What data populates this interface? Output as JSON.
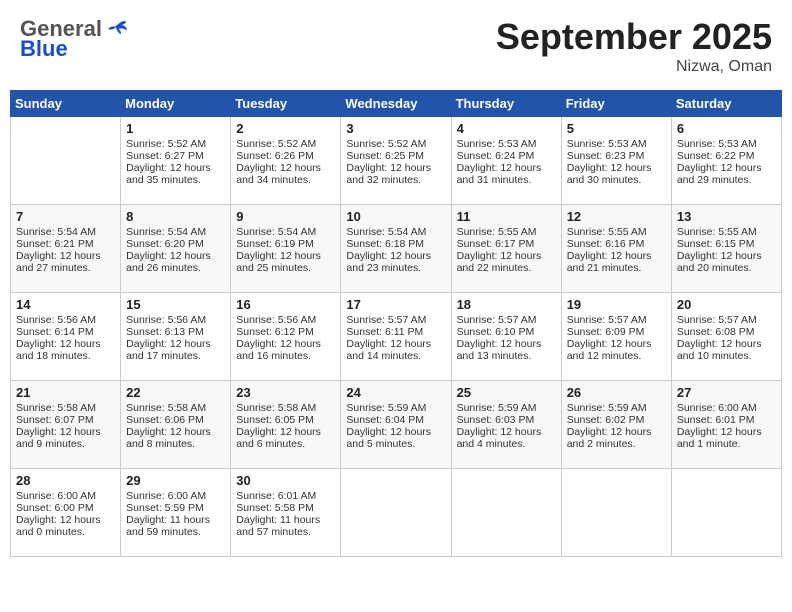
{
  "header": {
    "logo_general": "General",
    "logo_blue": "Blue",
    "title": "September 2025",
    "location": "Nizwa, Oman"
  },
  "weekdays": [
    "Sunday",
    "Monday",
    "Tuesday",
    "Wednesday",
    "Thursday",
    "Friday",
    "Saturday"
  ],
  "weeks": [
    [
      {
        "day": "",
        "content": ""
      },
      {
        "day": "1",
        "content": "Sunrise: 5:52 AM\nSunset: 6:27 PM\nDaylight: 12 hours\nand 35 minutes."
      },
      {
        "day": "2",
        "content": "Sunrise: 5:52 AM\nSunset: 6:26 PM\nDaylight: 12 hours\nand 34 minutes."
      },
      {
        "day": "3",
        "content": "Sunrise: 5:52 AM\nSunset: 6:25 PM\nDaylight: 12 hours\nand 32 minutes."
      },
      {
        "day": "4",
        "content": "Sunrise: 5:53 AM\nSunset: 6:24 PM\nDaylight: 12 hours\nand 31 minutes."
      },
      {
        "day": "5",
        "content": "Sunrise: 5:53 AM\nSunset: 6:23 PM\nDaylight: 12 hours\nand 30 minutes."
      },
      {
        "day": "6",
        "content": "Sunrise: 5:53 AM\nSunset: 6:22 PM\nDaylight: 12 hours\nand 29 minutes."
      }
    ],
    [
      {
        "day": "7",
        "content": "Sunrise: 5:54 AM\nSunset: 6:21 PM\nDaylight: 12 hours\nand 27 minutes."
      },
      {
        "day": "8",
        "content": "Sunrise: 5:54 AM\nSunset: 6:20 PM\nDaylight: 12 hours\nand 26 minutes."
      },
      {
        "day": "9",
        "content": "Sunrise: 5:54 AM\nSunset: 6:19 PM\nDaylight: 12 hours\nand 25 minutes."
      },
      {
        "day": "10",
        "content": "Sunrise: 5:54 AM\nSunset: 6:18 PM\nDaylight: 12 hours\nand 23 minutes."
      },
      {
        "day": "11",
        "content": "Sunrise: 5:55 AM\nSunset: 6:17 PM\nDaylight: 12 hours\nand 22 minutes."
      },
      {
        "day": "12",
        "content": "Sunrise: 5:55 AM\nSunset: 6:16 PM\nDaylight: 12 hours\nand 21 minutes."
      },
      {
        "day": "13",
        "content": "Sunrise: 5:55 AM\nSunset: 6:15 PM\nDaylight: 12 hours\nand 20 minutes."
      }
    ],
    [
      {
        "day": "14",
        "content": "Sunrise: 5:56 AM\nSunset: 6:14 PM\nDaylight: 12 hours\nand 18 minutes."
      },
      {
        "day": "15",
        "content": "Sunrise: 5:56 AM\nSunset: 6:13 PM\nDaylight: 12 hours\nand 17 minutes."
      },
      {
        "day": "16",
        "content": "Sunrise: 5:56 AM\nSunset: 6:12 PM\nDaylight: 12 hours\nand 16 minutes."
      },
      {
        "day": "17",
        "content": "Sunrise: 5:57 AM\nSunset: 6:11 PM\nDaylight: 12 hours\nand 14 minutes."
      },
      {
        "day": "18",
        "content": "Sunrise: 5:57 AM\nSunset: 6:10 PM\nDaylight: 12 hours\nand 13 minutes."
      },
      {
        "day": "19",
        "content": "Sunrise: 5:57 AM\nSunset: 6:09 PM\nDaylight: 12 hours\nand 12 minutes."
      },
      {
        "day": "20",
        "content": "Sunrise: 5:57 AM\nSunset: 6:08 PM\nDaylight: 12 hours\nand 10 minutes."
      }
    ],
    [
      {
        "day": "21",
        "content": "Sunrise: 5:58 AM\nSunset: 6:07 PM\nDaylight: 12 hours\nand 9 minutes."
      },
      {
        "day": "22",
        "content": "Sunrise: 5:58 AM\nSunset: 6:06 PM\nDaylight: 12 hours\nand 8 minutes."
      },
      {
        "day": "23",
        "content": "Sunrise: 5:58 AM\nSunset: 6:05 PM\nDaylight: 12 hours\nand 6 minutes."
      },
      {
        "day": "24",
        "content": "Sunrise: 5:59 AM\nSunset: 6:04 PM\nDaylight: 12 hours\nand 5 minutes."
      },
      {
        "day": "25",
        "content": "Sunrise: 5:59 AM\nSunset: 6:03 PM\nDaylight: 12 hours\nand 4 minutes."
      },
      {
        "day": "26",
        "content": "Sunrise: 5:59 AM\nSunset: 6:02 PM\nDaylight: 12 hours\nand 2 minutes."
      },
      {
        "day": "27",
        "content": "Sunrise: 6:00 AM\nSunset: 6:01 PM\nDaylight: 12 hours\nand 1 minute."
      }
    ],
    [
      {
        "day": "28",
        "content": "Sunrise: 6:00 AM\nSunset: 6:00 PM\nDaylight: 12 hours\nand 0 minutes."
      },
      {
        "day": "29",
        "content": "Sunrise: 6:00 AM\nSunset: 5:59 PM\nDaylight: 11 hours\nand 59 minutes."
      },
      {
        "day": "30",
        "content": "Sunrise: 6:01 AM\nSunset: 5:58 PM\nDaylight: 11 hours\nand 57 minutes."
      },
      {
        "day": "",
        "content": ""
      },
      {
        "day": "",
        "content": ""
      },
      {
        "day": "",
        "content": ""
      },
      {
        "day": "",
        "content": ""
      }
    ]
  ]
}
